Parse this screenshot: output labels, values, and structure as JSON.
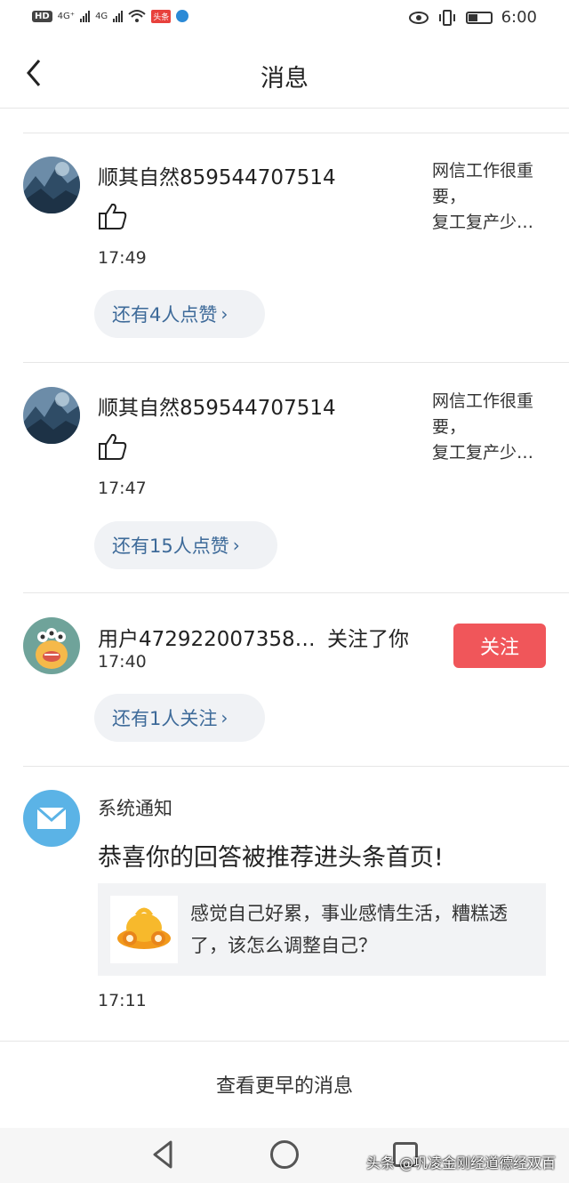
{
  "statusbar": {
    "hd": "HD",
    "sig1": "4G⁺",
    "sig2": "4G",
    "toutiao": "头条",
    "time": "6:00"
  },
  "nav": {
    "title": "消息"
  },
  "notifications": [
    {
      "user": "顺其自然859544707514",
      "time": "17:49",
      "quote": "网信工作很重要，\n复工复产少…",
      "more": "还有4人点赞"
    },
    {
      "user": "顺其自然859544707514",
      "time": "17:47",
      "quote": "网信工作很重要，\n复工复产少…",
      "more": "还有15人点赞"
    }
  ],
  "follow": {
    "user": "用户472922007358…",
    "action": "关注了你",
    "time": "17:40",
    "button": "关注",
    "more": "还有1人关注"
  },
  "system": {
    "title": "系统通知",
    "headline": "恭喜你的回答被推荐进头条首页!",
    "card_text": "感觉自己好累，事业感情生活，糟糕透了，该怎么调整自己？",
    "time": "17:11"
  },
  "earlier_link": "查看更早的消息",
  "watermark": "头条 @巩凌金刚经道德经双百",
  "colors": {
    "accent_red": "#f0565a",
    "pill_text": "#3d6a99",
    "pill_bg": "#f0f2f5"
  }
}
